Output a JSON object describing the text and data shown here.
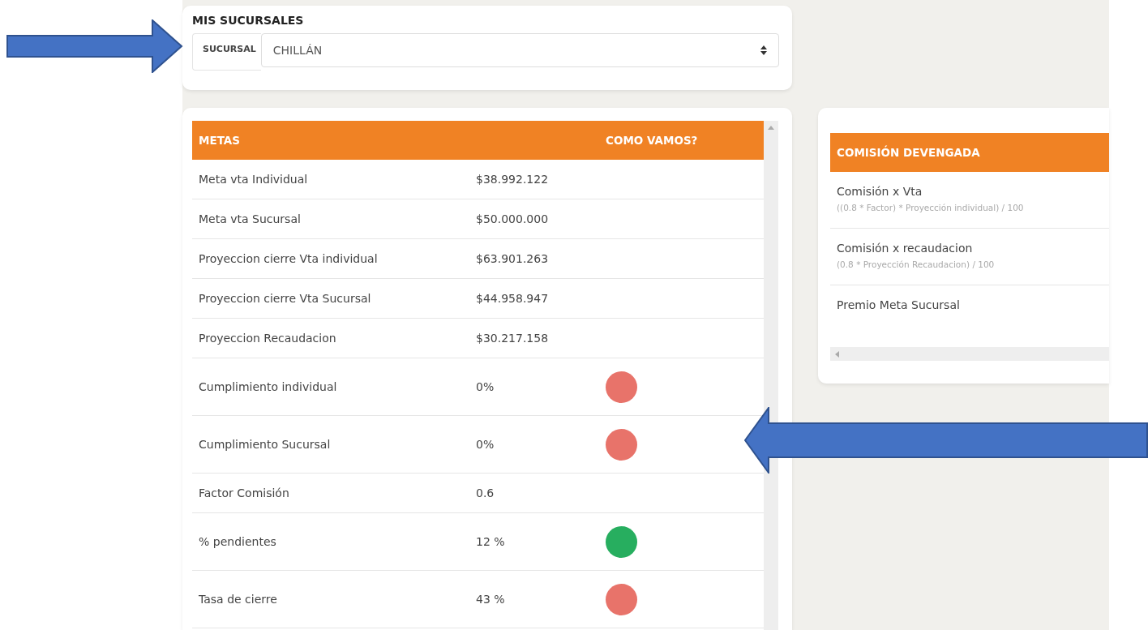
{
  "branches": {
    "title": "MIS SUCURSALES",
    "label": "SUCURSAL",
    "value": "CHILLÁN"
  },
  "goals": {
    "columns": [
      "METAS",
      "COMO VAMOS?"
    ],
    "rows": [
      {
        "name": "Meta vta Individual",
        "value": "$38.992.122"
      },
      {
        "name": "Meta vta Sucursal",
        "value": "$50.000.000"
      },
      {
        "name": "Proyeccion cierre Vta individual",
        "value": "$63.901.263"
      },
      {
        "name": "Proyeccion cierre Vta Sucursal",
        "value": "$44.958.947"
      },
      {
        "name": "Proyeccion Recaudacion",
        "value": "$30.217.158"
      },
      {
        "name": "Cumplimiento individual",
        "value": "0%",
        "color": "#e8736a"
      },
      {
        "name": "Cumplimiento Sucursal",
        "value": "0%",
        "color": "#e8736a"
      },
      {
        "name": "Factor Comisión",
        "value": "0.6"
      },
      {
        "name": "% pendientes",
        "value": "12 %",
        "color": "#27ae5f"
      },
      {
        "name": "Tasa de cierre",
        "value": "43 %",
        "color": "#e8736a"
      }
    ]
  },
  "commission": {
    "title": "COMISIÓN DEVENGADA",
    "rows": [
      {
        "name": "Comisión x Vta",
        "formula": "((0.8 * Factor) * Proyección individual) / 100"
      },
      {
        "name": "Comisión x recaudacion",
        "formula": "(0.8 * Proyección Recaudacion) / 100"
      },
      {
        "name": "Premio Meta Sucursal"
      }
    ]
  }
}
